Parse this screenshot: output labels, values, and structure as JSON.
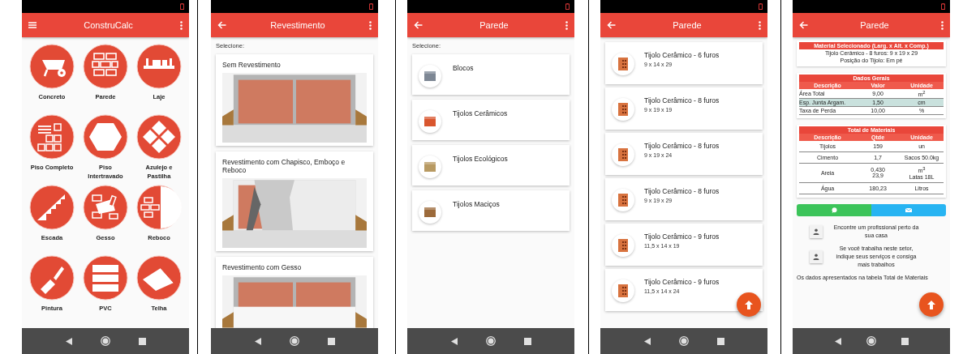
{
  "screens": [
    {
      "kind": "grid",
      "title": "ConstruCalc",
      "back_button": false,
      "items": [
        {
          "label": "Concreto"
        },
        {
          "label": "Parede"
        },
        {
          "label": "Laje"
        },
        {
          "label": "Piso Completo"
        },
        {
          "label": "Piso Intertravado"
        },
        {
          "label": "Azulejo e Pastilha"
        },
        {
          "label": "Escada"
        },
        {
          "label": "Gesso"
        },
        {
          "label": "Reboco"
        },
        {
          "label": "Pintura"
        },
        {
          "label": "PVC"
        },
        {
          "label": "Telha"
        }
      ]
    },
    {
      "kind": "images",
      "title": "Revestimento",
      "back_button": true,
      "prompt": "Selecione:",
      "cards": [
        {
          "label": "Sem Revestimento"
        },
        {
          "label": "Revestimento com Chapisco, Emboço e Reboco"
        },
        {
          "label": "Revestimento com Gesso"
        }
      ]
    },
    {
      "kind": "list",
      "title": "Parede",
      "back_button": true,
      "prompt": "Selecione:",
      "items": [
        {
          "label": "Blocos",
          "color": "#7d8794"
        },
        {
          "label": "Tijolos Cerâmicos",
          "color": "#d9562e"
        },
        {
          "label": "Tijolos Ecológicos",
          "color": "#b89a62"
        },
        {
          "label": "Tijolos Maciços",
          "color": "#9c6a3a"
        }
      ]
    },
    {
      "kind": "products",
      "title": "Parede",
      "back_button": true,
      "fab": true,
      "items": [
        {
          "name": "Tijolo Cerâmico - 6 furos",
          "size": "9 x 14 x 29"
        },
        {
          "name": "Tijolo Cerâmico - 8 furos",
          "size": "9 x 19 x 19"
        },
        {
          "name": "Tijolo Cerâmico - 8 furos",
          "size": "9 x 19 x 24"
        },
        {
          "name": "Tijolo Cerâmico - 8 furos",
          "size": "9 x 19 x 29"
        },
        {
          "name": "Tijolo Cerâmico - 9 furos",
          "size": "11,5 x 14 x 19"
        },
        {
          "name": "Tijolo Cerâmico - 9 furos",
          "size": "11,5 x 14 x 24"
        }
      ]
    },
    {
      "kind": "result",
      "title": "Parede",
      "back_button": true,
      "fab": true,
      "material": {
        "heading": "Material Selecionado (Larg. x Alt. x Comp.)",
        "lines": [
          "Tijolo Cerâmico - 8 furos: 9 x 19 x 29",
          "Posição do Tijolo: Em pé"
        ]
      },
      "tables": [
        {
          "kind": "values",
          "heading": "Dados Gerais",
          "columns": [
            "Descrição",
            "Valor",
            "Unidade"
          ],
          "rows": [
            {
              "cells": [
                [
                  "Área Total"
                ],
                [
                  "9,00"
                ],
                [
                  "m$^{2}$"
                ]
              ],
              "highlighted": false
            },
            {
              "cells": [
                [
                  "Esp. Junta Argam."
                ],
                [
                  "1,50"
                ],
                [
                  "cm"
                ]
              ],
              "highlighted": true
            },
            {
              "cells": [
                [
                  "Taxa de Perda"
                ],
                [
                  "10,00"
                ],
                [
                  "%"
                ]
              ],
              "highlighted": false
            }
          ]
        },
        {
          "kind": "totals",
          "heading": "Total de Materiais",
          "columns": [
            "Descrição",
            "Qtde",
            "Unidade"
          ],
          "rows": [
            {
              "cells": [
                [
                  "Tijolos"
                ],
                [
                  "159"
                ],
                [
                  "un"
                ]
              ],
              "highlighted": false
            },
            {
              "cells": [
                [
                  "Cimento"
                ],
                [
                  "1,7"
                ],
                [
                  "Sacos 50.0kg"
                ]
              ],
              "highlighted": false
            },
            {
              "cells": [
                [
                  "Areia"
                ],
                [
                  "0,430",
                  "23,9"
                ],
                [
                  "m$^{3}$",
                  "Latas 18L"
                ]
              ],
              "highlighted": false
            },
            {
              "cells": [
                [
                  "Água"
                ],
                [
                  "180,23"
                ],
                [
                  "Litros"
                ]
              ],
              "highlighted": false
            }
          ]
        }
      ],
      "share": [
        {
          "color": "#3cc45a"
        },
        {
          "color": "#27b4f2"
        }
      ],
      "links": [
        {
          "text": "Encontre um profissional perto da sua casa"
        },
        {
          "text": "Se você trabalha neste setor, indique seus serviços e consiga mais trabalhos"
        }
      ],
      "footnote": "Os dados apresentados na tabela Total de Materiais"
    }
  ]
}
